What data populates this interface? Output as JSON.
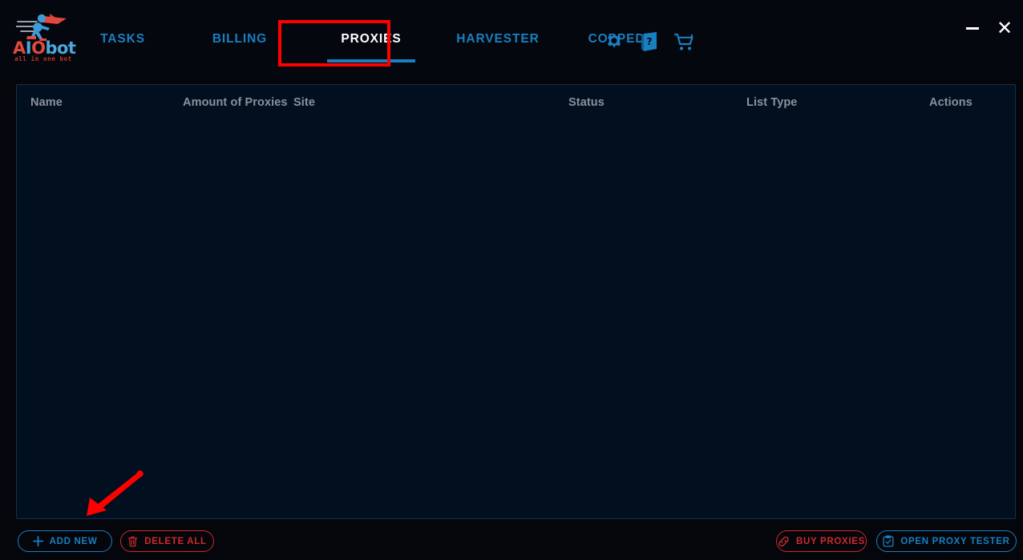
{
  "app": {
    "logo": {
      "word_a": "A",
      "word_i": "I",
      "word_o": "O",
      "word_bot": "bot",
      "tagline": "all in one bot",
      "icon": "runner-logo-icon"
    }
  },
  "nav": {
    "items": [
      {
        "label": "TASKS",
        "name": "tab-tasks",
        "active": false
      },
      {
        "label": "BILLING",
        "name": "tab-billing",
        "active": false
      },
      {
        "label": "PROXIES",
        "name": "tab-proxies",
        "active": true
      },
      {
        "label": "HARVESTER",
        "name": "tab-harvester",
        "active": false
      },
      {
        "label": "COPPED",
        "name": "tab-copped",
        "active": false
      }
    ],
    "icons": [
      {
        "name": "gear-icon",
        "title": "Settings"
      },
      {
        "name": "book-question-icon",
        "title": "Guide"
      },
      {
        "name": "shopping-cart-icon",
        "title": "Store"
      }
    ]
  },
  "window_controls": {
    "minimize_label": "—",
    "minimize_name": "minimize-icon",
    "close_label": "✕",
    "close_name": "close-icon"
  },
  "table": {
    "columns": [
      {
        "key": "name",
        "label": "Name"
      },
      {
        "key": "amount",
        "label": "Amount of Proxies"
      },
      {
        "key": "site",
        "label": "Site"
      },
      {
        "key": "status",
        "label": "Status"
      },
      {
        "key": "list",
        "label": "List Type"
      },
      {
        "key": "actions",
        "label": "Actions"
      }
    ],
    "rows": [],
    "empty": ""
  },
  "footer": {
    "buttons": [
      {
        "name": "add-new-button",
        "label": "ADD NEW",
        "icon": "plus-icon",
        "style": "blue"
      },
      {
        "name": "delete-all-button",
        "label": "DELETE ALL",
        "icon": "trash-icon",
        "style": "red"
      },
      {
        "name": "buy-proxies-button",
        "label": "BUY PROXIES",
        "icon": "link-icon",
        "style": "red"
      },
      {
        "name": "open-proxy-tester-button",
        "label": "OPEN PROXY TESTER",
        "icon": "clipboard-check-icon",
        "style": "blue"
      }
    ]
  },
  "annotations": {
    "highlight_box_target": "PROXIES",
    "arrow_target": "ADD NEW",
    "color": "#fe0000"
  },
  "colors": {
    "accent_blue": "#1a7fc1",
    "accent_red": "#cf2a2a",
    "logo_red": "#e2483c",
    "bg_topbar": "#04070d",
    "bg_panel": "#020f1f",
    "panel_border": "#12304d",
    "header_text": "#8b919c",
    "annotation_red": "#fe0000"
  }
}
